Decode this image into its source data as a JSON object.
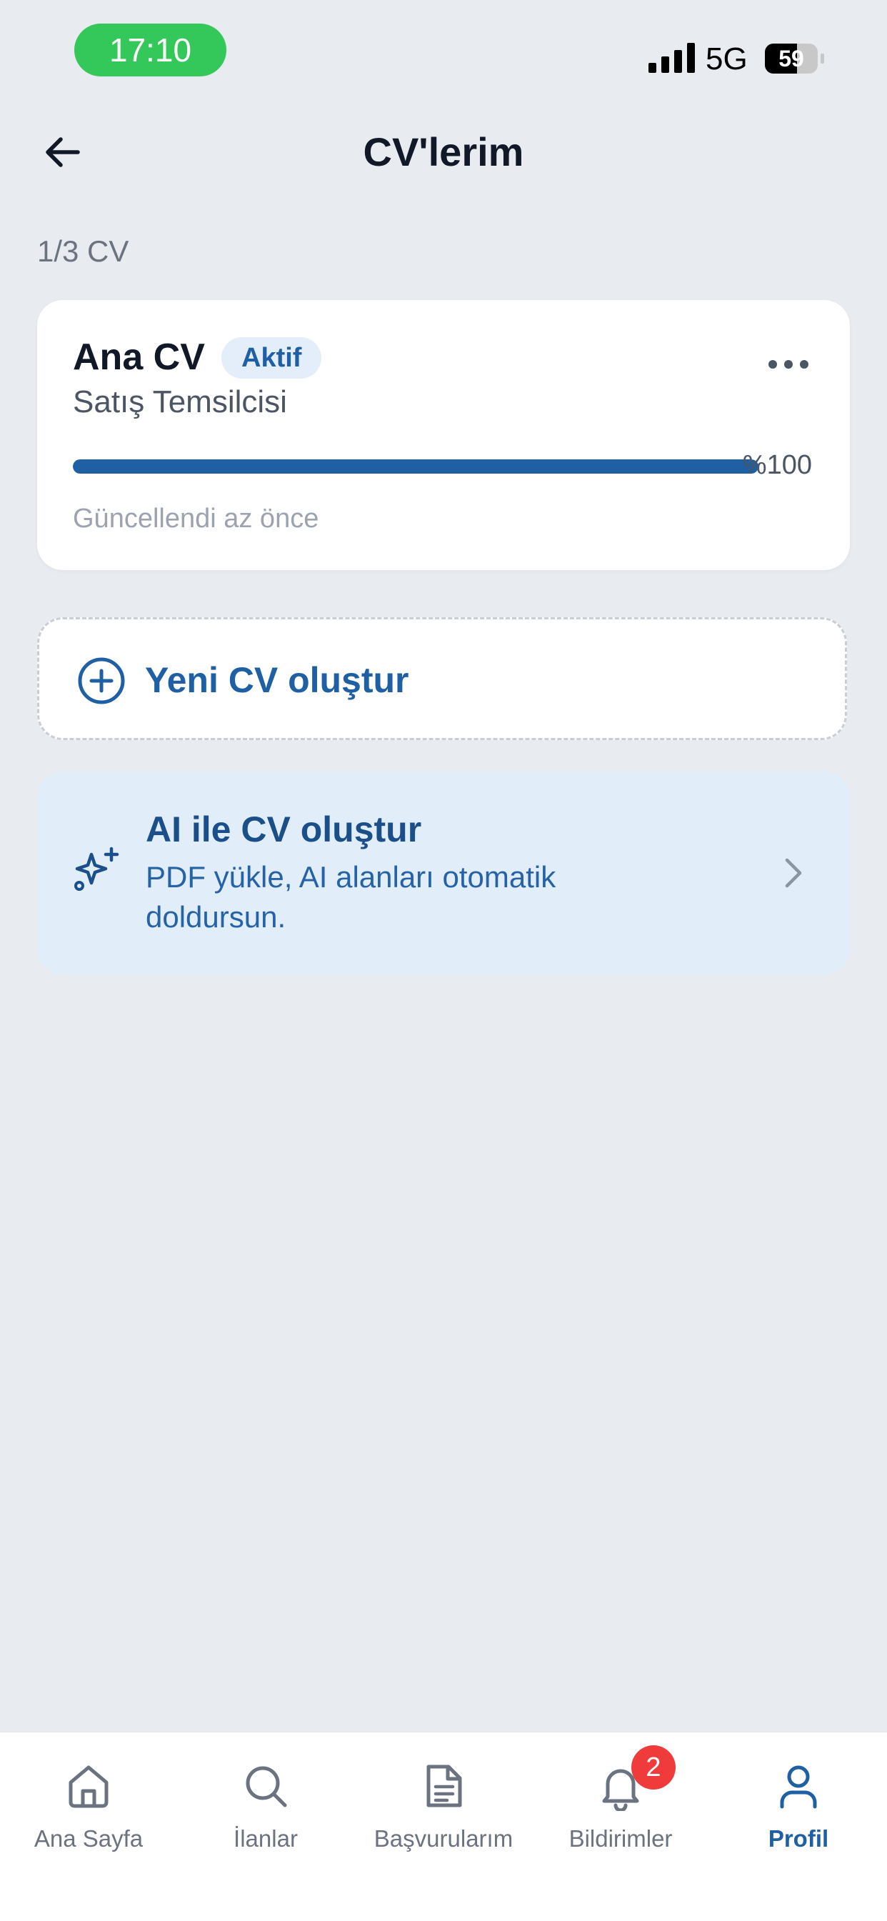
{
  "status_bar": {
    "time": "17:10",
    "network": "5G",
    "battery": "59"
  },
  "header": {
    "title": "CV'lerim"
  },
  "cv_count": "1/3 CV",
  "cv_card": {
    "name": "Ana CV",
    "badge": "Aktif",
    "role": "Satış Temsilcisi",
    "progress_label": "%100",
    "progress_percent": 100,
    "updated": "Güncellendi az önce"
  },
  "new_cv": {
    "label": "Yeni CV oluştur"
  },
  "ai_card": {
    "title": "AI ile CV oluştur",
    "description": "PDF yükle, AI alanları otomatik doldursun."
  },
  "bottom_nav": {
    "items": [
      {
        "label": "Ana Sayfa",
        "icon": "home-icon"
      },
      {
        "label": "İlanlar",
        "icon": "search-icon"
      },
      {
        "label": "Başvurularım",
        "icon": "document-icon"
      },
      {
        "label": "Bildirimler",
        "icon": "bell-icon",
        "badge": "2"
      },
      {
        "label": "Profil",
        "icon": "profile-icon",
        "active": true
      }
    ]
  },
  "colors": {
    "accent": "#1F5FA3",
    "background": "#E8EBF0",
    "ai_card_bg": "#E1EDF9",
    "badge_red": "#EF3B3B",
    "time_pill": "#34C759"
  }
}
